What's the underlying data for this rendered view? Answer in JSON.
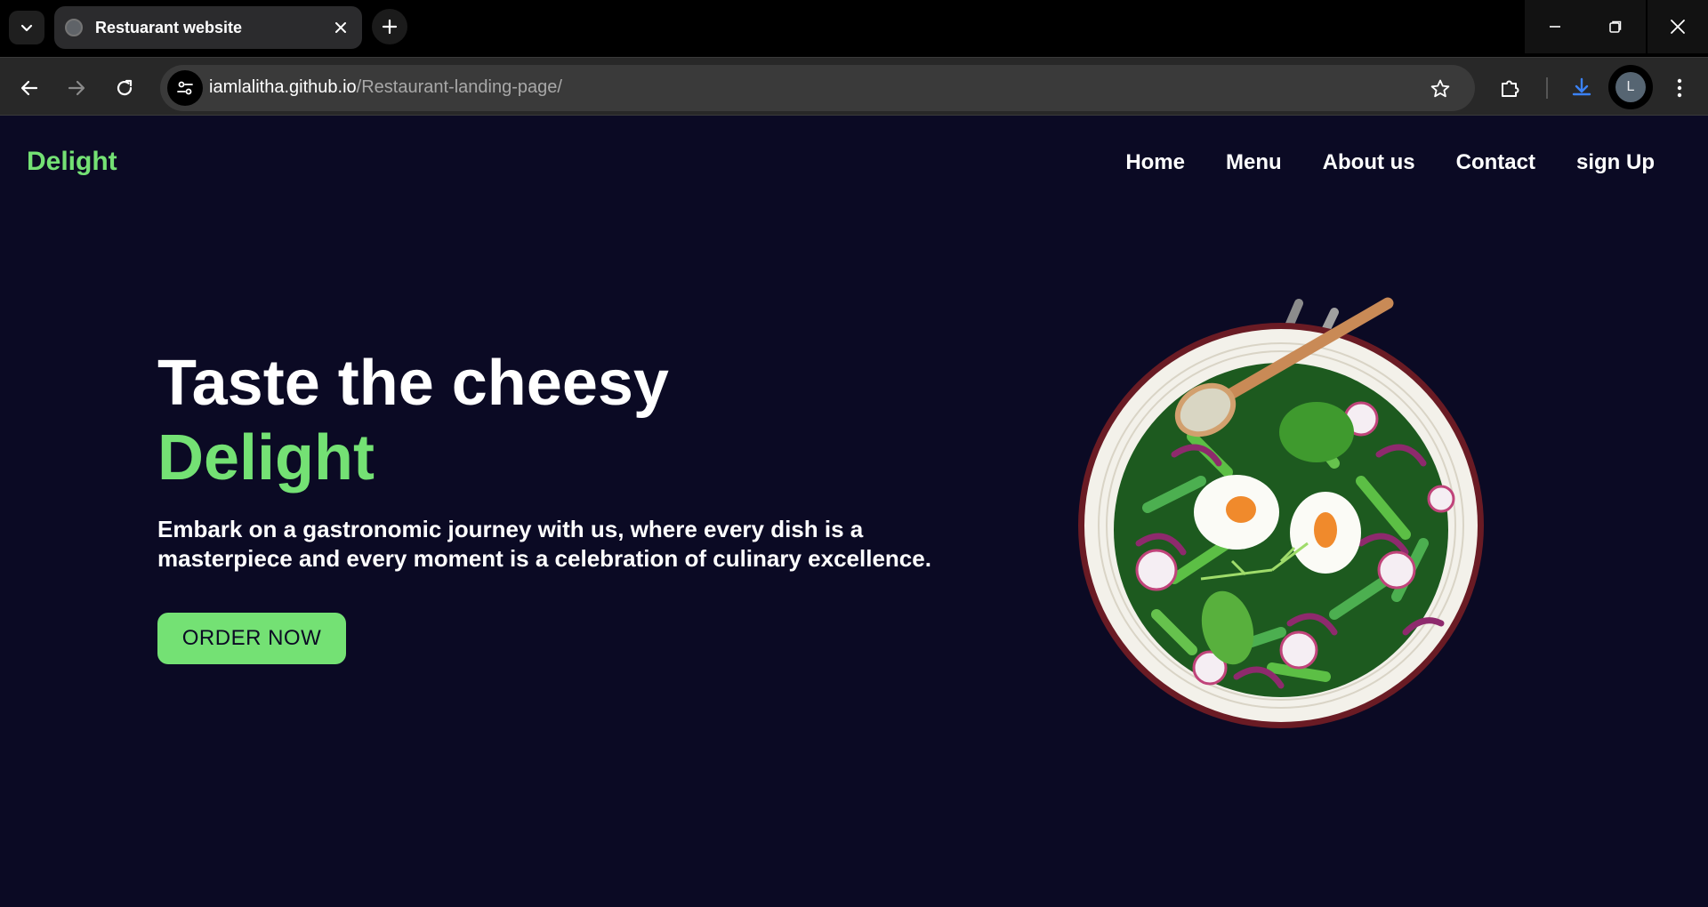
{
  "browser": {
    "tab_title": "Restuarant website",
    "url_host": "iamlalitha.github.io",
    "url_path": "/Restaurant-landing-page/",
    "profile_initial": "L"
  },
  "site": {
    "logo": "Delight",
    "nav": [
      "Home",
      "Menu",
      "About us",
      "Contact",
      "sign Up"
    ],
    "hero": {
      "title": "Taste the cheesy",
      "title_accent": "Delight",
      "description": "Embark on a gastronomic journey with us, where every dish is a masterpiece and every moment is a celebration of culinary excellence.",
      "cta": "ORDER NOW"
    }
  },
  "colors": {
    "background": "#0b0a24",
    "accent": "#74e174"
  },
  "icons": [
    "tab-search-icon",
    "globe-icon",
    "close-icon",
    "plus-icon",
    "minimize-icon",
    "restore-icon",
    "back-arrow-icon",
    "forward-arrow-icon",
    "reload-icon",
    "site-info-icon",
    "star-icon",
    "extensions-icon",
    "download-icon",
    "more-vert-icon"
  ]
}
